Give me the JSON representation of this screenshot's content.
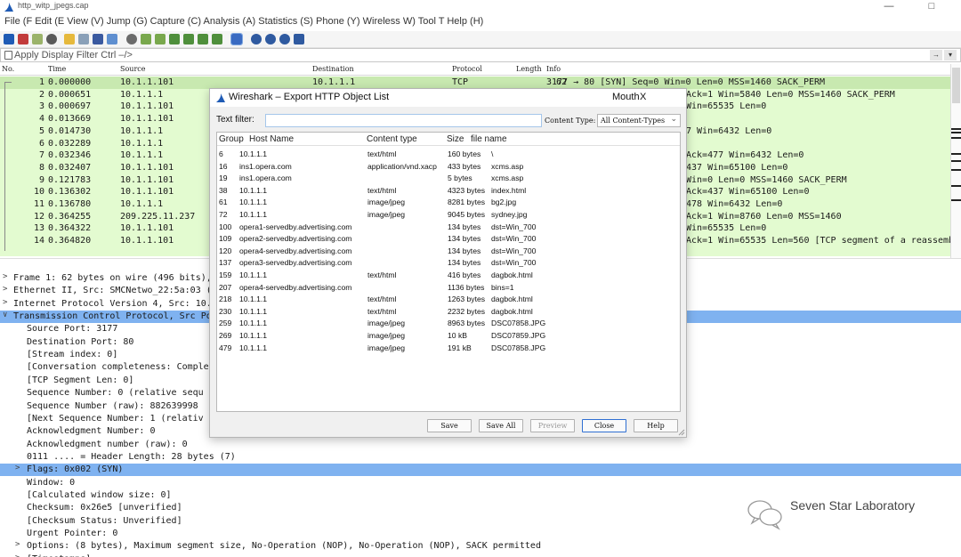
{
  "window": {
    "title": "http_witp_jpegs.cap"
  },
  "menubar": {
    "text": "File (F Edit (E View (V) Jump (G) Capture (C) Analysis (A) Statistics (S) Phone (Y) Wireless W) Tool T Help (H)"
  },
  "filter": {
    "placeholder": "Apply Display Filter Ctrl –/>"
  },
  "packet_list": {
    "headers": {
      "no": "No.",
      "time": "Time",
      "source": "Source",
      "destination": "Destination",
      "protocol": "Protocol",
      "length": "Length",
      "info": "Info"
    },
    "rows": [
      {
        "no": "1",
        "time": "0.000000",
        "source": "10.1.1.101",
        "dest": "10.1.1.1",
        "proto": "TCP",
        "len": "62",
        "info": "3177 → 80 [SYN] Seq=0 Win=0 Len=0 MSS=1460 SACK_PERM"
      },
      {
        "no": "2",
        "time": "0.000651",
        "source": "10.1.1.1",
        "dest": "",
        "proto": "",
        "len": "",
        "info": "Ack=1 Win=5840 Len=0 MSS=1460 SACK_PERM"
      },
      {
        "no": "3",
        "time": "0.000697",
        "source": "10.1.1.101",
        "dest": "",
        "proto": "",
        "len": "",
        "info": "Win=65535 Len=0"
      },
      {
        "no": "4",
        "time": "0.013669",
        "source": "10.1.1.101",
        "dest": "",
        "proto": "",
        "len": "",
        "info": ""
      },
      {
        "no": "5",
        "time": "0.014730",
        "source": "10.1.1.1",
        "dest": "",
        "proto": "",
        "len": "",
        "info": "7 Win=6432 Len=0"
      },
      {
        "no": "6",
        "time": "0.032289",
        "source": "10.1.1.1",
        "dest": "",
        "proto": "",
        "len": "",
        "info": ""
      },
      {
        "no": "7",
        "time": "0.032346",
        "source": "10.1.1.1",
        "dest": "",
        "proto": "",
        "len": "",
        "info": "Ack=477 Win=6432 Len=0"
      },
      {
        "no": "8",
        "time": "0.032407",
        "source": "10.1.1.101",
        "dest": "",
        "proto": "",
        "len": "",
        "info": "437 Win=65100 Len=0"
      },
      {
        "no": "9",
        "time": "0.121783",
        "source": "10.1.1.101",
        "dest": "",
        "proto": "",
        "len": "",
        "info": "Win=0 Len=0 MSS=1460 SACK_PERM"
      },
      {
        "no": "10",
        "time": "0.136302",
        "source": "10.1.1.101",
        "dest": "",
        "proto": "",
        "len": "",
        "info": "Ack=437 Win=65100 Len=0"
      },
      {
        "no": "11",
        "time": "0.136780",
        "source": "10.1.1.1",
        "dest": "",
        "proto": "",
        "len": "",
        "info": "478 Win=6432 Len=0"
      },
      {
        "no": "12",
        "time": "0.364255",
        "source": "209.225.11.237",
        "dest": "",
        "proto": "",
        "len": "",
        "info": "Ack=1 Win=8760 Len=0 MSS=1460"
      },
      {
        "no": "13",
        "time": "0.364322",
        "source": "10.1.1.101",
        "dest": "",
        "proto": "",
        "len": "",
        "info": "Win=65535 Len=0"
      },
      {
        "no": "14",
        "time": "0.364820",
        "source": "10.1.1.101",
        "dest": "",
        "proto": "",
        "len": "",
        "info": "Ack=1 Win=65535 Len=560 [TCP segment of a reassemble"
      }
    ]
  },
  "details": {
    "rows": [
      {
        "arrow": ">",
        "text": "Frame 1: 62 bytes on wire (496 bits),"
      },
      {
        "arrow": ">",
        "text": "Ethernet II, Src: SMCNetwo_22:5a:03 (0"
      },
      {
        "arrow": ">",
        "text": "Internet Protocol Version 4, Src: 10.1"
      },
      {
        "arrow": "∨",
        "text": "Transmission Control Protocol, Src Por",
        "selected": true
      },
      {
        "arrow": "",
        "text": "Source Port: 3177"
      },
      {
        "arrow": "",
        "text": "Destination Port: 80"
      },
      {
        "arrow": "",
        "text": "[Stream index: 0]"
      },
      {
        "arrow": "",
        "text": "[Conversation completeness: Complete"
      },
      {
        "arrow": "",
        "text": "[TCP Segment Len: 0]"
      },
      {
        "arrow": "",
        "text": "Sequence Number: 0    (relative sequ"
      },
      {
        "arrow": "",
        "text": "Sequence Number (raw): 882639998"
      },
      {
        "arrow": "",
        "text": "[Next Sequence Number: 1    (relativ"
      },
      {
        "arrow": "",
        "text": "Acknowledgment Number: 0"
      },
      {
        "arrow": "",
        "text": "Acknowledgment number (raw): 0"
      },
      {
        "arrow": "",
        "text": "0111 .... = Header Length: 28 bytes (7)"
      },
      {
        "arrow": ">",
        "text": "Flags: 0x002 (SYN)",
        "selected": true
      },
      {
        "arrow": "",
        "text": "Window: 0"
      },
      {
        "arrow": "",
        "text": "[Calculated window size: 0]"
      },
      {
        "arrow": "",
        "text": "Checksum: 0x26e5 [unverified]"
      },
      {
        "arrow": "",
        "text": "[Checksum Status: Unverified]"
      },
      {
        "arrow": "",
        "text": "Urgent Pointer: 0"
      },
      {
        "arrow": ">",
        "text": "Options: (8 bytes), Maximum segment size, No-Operation (NOP), No-Operation (NOP), SACK permitted"
      },
      {
        "arrow": ">",
        "text": "[Timestamps]"
      }
    ]
  },
  "dialog": {
    "title": "Wireshark – Export HTTP Object List",
    "help_glyph": "Mouth",
    "close_glyph": "X",
    "text_filter_label": "Text filter:",
    "text_filter_value": "",
    "content_type_label": "Content Type:",
    "content_type_value": "All Content-Types",
    "headers": {
      "group": "Group",
      "host": "Host Name",
      "content_type": "Content type",
      "size": "Size",
      "filename": "file name"
    },
    "rows": [
      {
        "group": "6",
        "host": "10.1.1.1",
        "content_type": "text/html",
        "size": "160 bytes",
        "filename": "\\"
      },
      {
        "group": "16",
        "host": "ins1.opera.com",
        "content_type": "application/vnd.xacp",
        "size": "433 bytes",
        "filename": "xcms.asp"
      },
      {
        "group": "19",
        "host": "ins1.opera.com",
        "content_type": "",
        "size": "5 bytes",
        "filename": "xcms.asp"
      },
      {
        "group": "38",
        "host": "10.1.1.1",
        "content_type": "text/html",
        "size": "4323 bytes",
        "filename": "index.html"
      },
      {
        "group": "61",
        "host": "10.1.1.1",
        "content_type": "image/jpeg",
        "size": "8281 bytes",
        "filename": "bg2.jpg"
      },
      {
        "group": "72",
        "host": "10.1.1.1",
        "content_type": "image/jpeg",
        "size": "9045 bytes",
        "filename": "sydney.jpg"
      },
      {
        "group": "100",
        "host": "opera1-servedby.advertising.com",
        "content_type": "",
        "size": "134 bytes",
        "filename": "dst=Win_700"
      },
      {
        "group": "109",
        "host": "opera2-servedby.advertising.com",
        "content_type": "",
        "size": "134 bytes",
        "filename": "dst=Win_700"
      },
      {
        "group": "120",
        "host": "opera4-servedby.advertising.com",
        "content_type": "",
        "size": "134 bytes",
        "filename": "dst=Win_700"
      },
      {
        "group": "137",
        "host": "opera3-servedby.advertising.com",
        "content_type": "",
        "size": "134 bytes",
        "filename": "dst=Win_700"
      },
      {
        "group": "159",
        "host": "10.1.1.1",
        "content_type": "text/html",
        "size": "416 bytes",
        "filename": "dagbok.html"
      },
      {
        "group": "207",
        "host": "opera4-servedby.advertising.com",
        "content_type": "",
        "size": "1136 bytes",
        "filename": "bins=1"
      },
      {
        "group": "218",
        "host": "10.1.1.1",
        "content_type": "text/html",
        "size": "1263 bytes",
        "filename": "dagbok.html"
      },
      {
        "group": "230",
        "host": "10.1.1.1",
        "content_type": "text/html",
        "size": "2232 bytes",
        "filename": "dagbok.html"
      },
      {
        "group": "259",
        "host": "10.1.1.1",
        "content_type": "image/jpeg",
        "size": "8963 bytes",
        "filename": "DSC07858.JPG"
      },
      {
        "group": "269",
        "host": "10.1.1.1",
        "content_type": "image/jpeg",
        "size": "10 kB",
        "filename": "DSC07859.JPG"
      },
      {
        "group": "479",
        "host": "10.1.1.1",
        "content_type": "image/jpeg",
        "size": "191 kB",
        "filename": "DSC07858.JPG"
      }
    ],
    "buttons": {
      "save": "Save",
      "save_all": "Save All",
      "preview": "Preview",
      "close": "Close",
      "help": "Help"
    }
  },
  "watermark": {
    "text": "Seven Star Laboratory"
  },
  "colors": {
    "packet_bg": "#e3fbd0",
    "selected_detail": "#7fb2f0",
    "accent": "#2f6fd2",
    "shark_fin": "#1f5bb5"
  }
}
